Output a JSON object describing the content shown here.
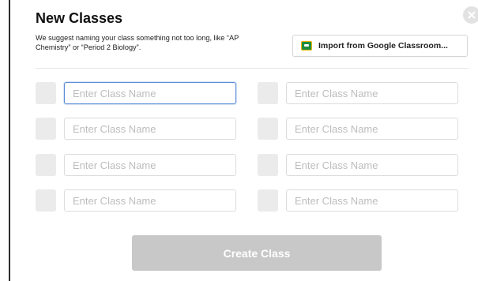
{
  "modal": {
    "title": "New Classes",
    "subtitle": "We suggest naming your class something not too long, like “AP Chemistry” or “Period 2 Biology”.",
    "import_button": {
      "label": "Import from Google Classroom...",
      "icon": "google-classroom-icon"
    },
    "close_icon": "close-icon"
  },
  "class_inputs": [
    {
      "placeholder": "Enter Class Name",
      "value": "",
      "focused": true
    },
    {
      "placeholder": "Enter Class Name",
      "value": ""
    },
    {
      "placeholder": "Enter Class Name",
      "value": ""
    },
    {
      "placeholder": "Enter Class Name",
      "value": ""
    },
    {
      "placeholder": "Enter Class Name",
      "value": ""
    },
    {
      "placeholder": "Enter Class Name",
      "value": ""
    },
    {
      "placeholder": "Enter Class Name",
      "value": ""
    },
    {
      "placeholder": "Enter Class Name",
      "value": ""
    }
  ],
  "create_button": {
    "label": "Create Class",
    "state": "disabled"
  },
  "colors": {
    "focus_border": "#5b8dd9",
    "swatch": "#ebebeb",
    "create_button_bg": "#c8c8c8",
    "google_classroom_green": "#1e8e3e"
  }
}
